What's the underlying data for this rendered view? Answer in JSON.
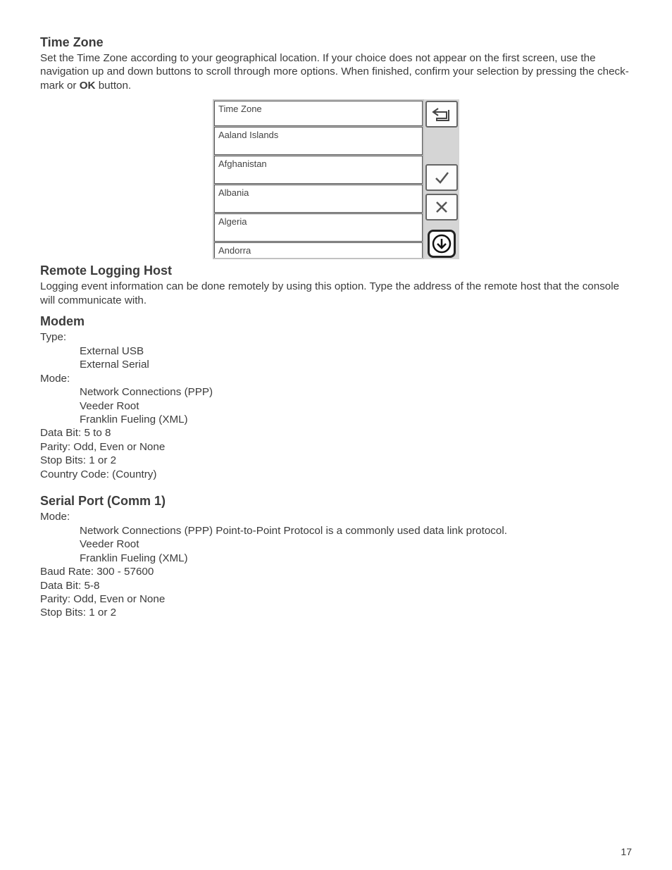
{
  "timezone": {
    "heading": "Time Zone",
    "desc_pre": "Set the Time Zone according to your geographical location. If your choice does not appear on the first screen, use the navigation up and down buttons to scroll through more options. When finished, confirm your selection by pressing the check-mark or ",
    "desc_bold": "OK",
    "desc_post": " button.",
    "list_header": "Time Zone",
    "items": [
      "Aaland Islands",
      "Afghanistan",
      "Albania",
      "Algeria",
      "Andorra"
    ]
  },
  "remote": {
    "heading": "Remote Logging Host",
    "desc": "Logging event information can be done remotely by using this option. Type the address of the remote host that the console will communicate with."
  },
  "modem": {
    "heading": "Modem",
    "type_label": "Type:",
    "type_items": [
      "External USB",
      "External Serial"
    ],
    "mode_label": "Mode:",
    "mode_items": [
      "Network Connections (PPP)",
      "Veeder Root",
      "Franklin Fueling (XML)"
    ],
    "databit": "Data Bit: 5 to 8",
    "parity": "Parity: Odd, Even or None",
    "stopbits": "Stop Bits: 1 or 2",
    "country": "Country Code: (Country)"
  },
  "serial": {
    "heading": "Serial Port (Comm 1)",
    "mode_label": "Mode:",
    "mode_items": [
      "Network Connections (PPP) Point-to-Point Protocol is a commonly used data link protocol.",
      "Veeder Root",
      "Franklin Fueling (XML)"
    ],
    "baud": "Baud Rate:  300 - 57600",
    "databit": "Data Bit:  5-8",
    "parity": "Parity: Odd, Even or None",
    "stopbits": "Stop Bits: 1 or 2"
  },
  "page_number": "17"
}
